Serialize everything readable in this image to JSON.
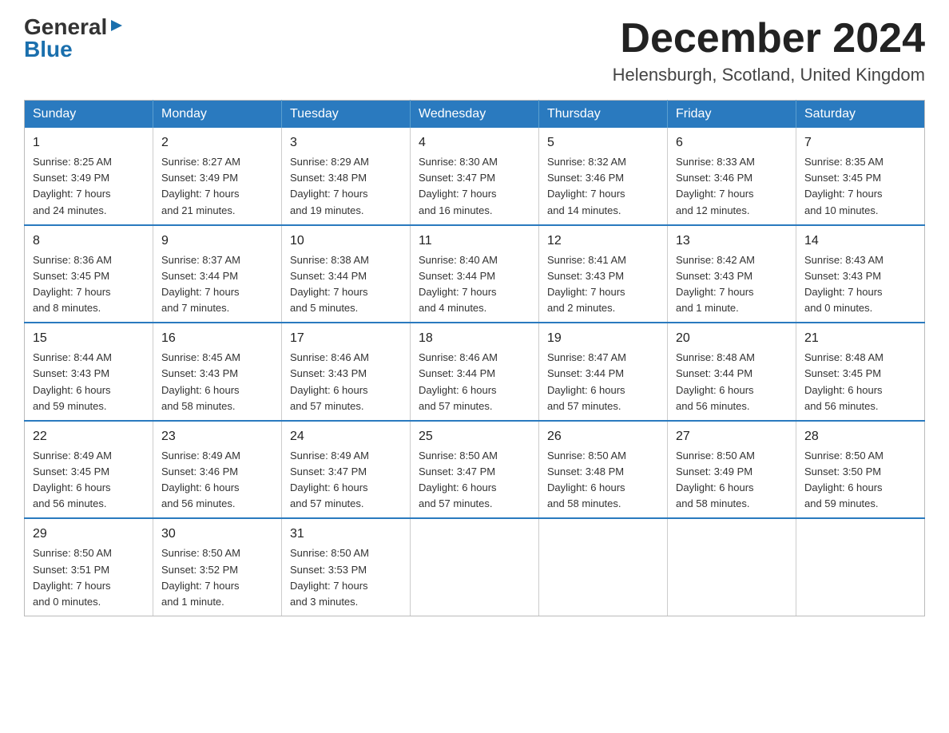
{
  "header": {
    "logo_general": "General",
    "logo_blue": "Blue",
    "month_title": "December 2024",
    "location": "Helensburgh, Scotland, United Kingdom"
  },
  "weekdays": [
    "Sunday",
    "Monday",
    "Tuesday",
    "Wednesday",
    "Thursday",
    "Friday",
    "Saturday"
  ],
  "weeks": [
    [
      {
        "day": "1",
        "sunrise": "8:25 AM",
        "sunset": "3:49 PM",
        "daylight": "7 hours and 24 minutes."
      },
      {
        "day": "2",
        "sunrise": "8:27 AM",
        "sunset": "3:49 PM",
        "daylight": "7 hours and 21 minutes."
      },
      {
        "day": "3",
        "sunrise": "8:29 AM",
        "sunset": "3:48 PM",
        "daylight": "7 hours and 19 minutes."
      },
      {
        "day": "4",
        "sunrise": "8:30 AM",
        "sunset": "3:47 PM",
        "daylight": "7 hours and 16 minutes."
      },
      {
        "day": "5",
        "sunrise": "8:32 AM",
        "sunset": "3:46 PM",
        "daylight": "7 hours and 14 minutes."
      },
      {
        "day": "6",
        "sunrise": "8:33 AM",
        "sunset": "3:46 PM",
        "daylight": "7 hours and 12 minutes."
      },
      {
        "day": "7",
        "sunrise": "8:35 AM",
        "sunset": "3:45 PM",
        "daylight": "7 hours and 10 minutes."
      }
    ],
    [
      {
        "day": "8",
        "sunrise": "8:36 AM",
        "sunset": "3:45 PM",
        "daylight": "7 hours and 8 minutes."
      },
      {
        "day": "9",
        "sunrise": "8:37 AM",
        "sunset": "3:44 PM",
        "daylight": "7 hours and 7 minutes."
      },
      {
        "day": "10",
        "sunrise": "8:38 AM",
        "sunset": "3:44 PM",
        "daylight": "7 hours and 5 minutes."
      },
      {
        "day": "11",
        "sunrise": "8:40 AM",
        "sunset": "3:44 PM",
        "daylight": "7 hours and 4 minutes."
      },
      {
        "day": "12",
        "sunrise": "8:41 AM",
        "sunset": "3:43 PM",
        "daylight": "7 hours and 2 minutes."
      },
      {
        "day": "13",
        "sunrise": "8:42 AM",
        "sunset": "3:43 PM",
        "daylight": "7 hours and 1 minute."
      },
      {
        "day": "14",
        "sunrise": "8:43 AM",
        "sunset": "3:43 PM",
        "daylight": "7 hours and 0 minutes."
      }
    ],
    [
      {
        "day": "15",
        "sunrise": "8:44 AM",
        "sunset": "3:43 PM",
        "daylight": "6 hours and 59 minutes."
      },
      {
        "day": "16",
        "sunrise": "8:45 AM",
        "sunset": "3:43 PM",
        "daylight": "6 hours and 58 minutes."
      },
      {
        "day": "17",
        "sunrise": "8:46 AM",
        "sunset": "3:43 PM",
        "daylight": "6 hours and 57 minutes."
      },
      {
        "day": "18",
        "sunrise": "8:46 AM",
        "sunset": "3:44 PM",
        "daylight": "6 hours and 57 minutes."
      },
      {
        "day": "19",
        "sunrise": "8:47 AM",
        "sunset": "3:44 PM",
        "daylight": "6 hours and 57 minutes."
      },
      {
        "day": "20",
        "sunrise": "8:48 AM",
        "sunset": "3:44 PM",
        "daylight": "6 hours and 56 minutes."
      },
      {
        "day": "21",
        "sunrise": "8:48 AM",
        "sunset": "3:45 PM",
        "daylight": "6 hours and 56 minutes."
      }
    ],
    [
      {
        "day": "22",
        "sunrise": "8:49 AM",
        "sunset": "3:45 PM",
        "daylight": "6 hours and 56 minutes."
      },
      {
        "day": "23",
        "sunrise": "8:49 AM",
        "sunset": "3:46 PM",
        "daylight": "6 hours and 56 minutes."
      },
      {
        "day": "24",
        "sunrise": "8:49 AM",
        "sunset": "3:47 PM",
        "daylight": "6 hours and 57 minutes."
      },
      {
        "day": "25",
        "sunrise": "8:50 AM",
        "sunset": "3:47 PM",
        "daylight": "6 hours and 57 minutes."
      },
      {
        "day": "26",
        "sunrise": "8:50 AM",
        "sunset": "3:48 PM",
        "daylight": "6 hours and 58 minutes."
      },
      {
        "day": "27",
        "sunrise": "8:50 AM",
        "sunset": "3:49 PM",
        "daylight": "6 hours and 58 minutes."
      },
      {
        "day": "28",
        "sunrise": "8:50 AM",
        "sunset": "3:50 PM",
        "daylight": "6 hours and 59 minutes."
      }
    ],
    [
      {
        "day": "29",
        "sunrise": "8:50 AM",
        "sunset": "3:51 PM",
        "daylight": "7 hours and 0 minutes."
      },
      {
        "day": "30",
        "sunrise": "8:50 AM",
        "sunset": "3:52 PM",
        "daylight": "7 hours and 1 minute."
      },
      {
        "day": "31",
        "sunrise": "8:50 AM",
        "sunset": "3:53 PM",
        "daylight": "7 hours and 3 minutes."
      },
      null,
      null,
      null,
      null
    ]
  ],
  "labels": {
    "sunrise": "Sunrise:",
    "sunset": "Sunset:",
    "daylight": "Daylight:"
  }
}
